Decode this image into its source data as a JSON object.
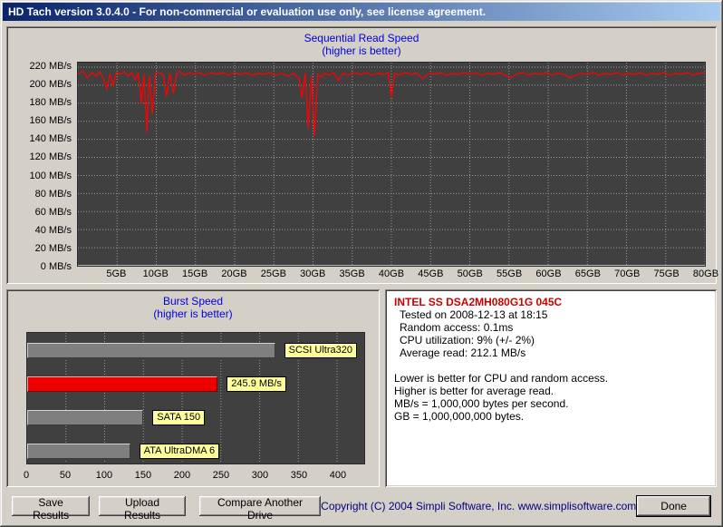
{
  "window": {
    "title": "HD Tach version 3.0.4.0  - For non-commercial or evaluation use only, see license agreement."
  },
  "chart_data": [
    {
      "type": "line",
      "title": "Sequential Read Speed",
      "subtitle": "(higher is better)",
      "series_name": "Sequential read speed",
      "x_unit": "GB",
      "y_unit": "MB/s",
      "xlim": [
        0,
        80
      ],
      "ylim": [
        0,
        225
      ],
      "grid": "dotted",
      "legend": "none",
      "line_color": "#ff0000",
      "plot_bg": "#404040",
      "y_ticks": [
        {
          "v": 220,
          "label": "220 MB/s"
        },
        {
          "v": 200,
          "label": "200 MB/s"
        },
        {
          "v": 180,
          "label": "180 MB/s"
        },
        {
          "v": 160,
          "label": "160 MB/s"
        },
        {
          "v": 140,
          "label": "140 MB/s"
        },
        {
          "v": 120,
          "label": "120 MB/s"
        },
        {
          "v": 100,
          "label": "100 MB/s"
        },
        {
          "v": 80,
          "label": "80 MB/s"
        },
        {
          "v": 60,
          "label": "60 MB/s"
        },
        {
          "v": 40,
          "label": "40 MB/s"
        },
        {
          "v": 20,
          "label": "20 MB/s"
        },
        {
          "v": 0,
          "label": "0 MB/s"
        }
      ],
      "x_ticks": [
        {
          "v": 5,
          "label": "5GB"
        },
        {
          "v": 10,
          "label": "10GB"
        },
        {
          "v": 15,
          "label": "15GB"
        },
        {
          "v": 20,
          "label": "20GB"
        },
        {
          "v": 25,
          "label": "25GB"
        },
        {
          "v": 30,
          "label": "30GB"
        },
        {
          "v": 35,
          "label": "35GB"
        },
        {
          "v": 40,
          "label": "40GB"
        },
        {
          "v": 45,
          "label": "45GB"
        },
        {
          "v": 50,
          "label": "50GB"
        },
        {
          "v": 55,
          "label": "55GB"
        },
        {
          "v": 60,
          "label": "60GB"
        },
        {
          "v": 65,
          "label": "65GB"
        },
        {
          "v": 70,
          "label": "70GB"
        },
        {
          "v": 75,
          "label": "75GB"
        },
        {
          "v": 80,
          "label": "80GB"
        }
      ],
      "points": [
        [
          0,
          213
        ],
        [
          0.7,
          215
        ],
        [
          1.2,
          208
        ],
        [
          1.8,
          214
        ],
        [
          2.3,
          210
        ],
        [
          2.8,
          215
        ],
        [
          3.3,
          206
        ],
        [
          3.7,
          196
        ],
        [
          4.1,
          213
        ],
        [
          4.5,
          199
        ],
        [
          4.9,
          214
        ],
        [
          5.4,
          212
        ],
        [
          5.9,
          215
        ],
        [
          6.4,
          210
        ],
        [
          6.9,
          214
        ],
        [
          7.3,
          206
        ],
        [
          7.7,
          213
        ],
        [
          8.1,
          179
        ],
        [
          8.4,
          212
        ],
        [
          8.8,
          148
        ],
        [
          9.1,
          211
        ],
        [
          9.5,
          168
        ],
        [
          9.9,
          213
        ],
        [
          10.4,
          214
        ],
        [
          10.9,
          211
        ],
        [
          11.3,
          187
        ],
        [
          11.7,
          213
        ],
        [
          12.2,
          191
        ],
        [
          12.6,
          213
        ],
        [
          13,
          215
        ],
        [
          13.6,
          211
        ],
        [
          14.2,
          214
        ],
        [
          14.8,
          212
        ],
        [
          15.5,
          214
        ],
        [
          16.2,
          211
        ],
        [
          17,
          214
        ],
        [
          17.8,
          212
        ],
        [
          18.5,
          214
        ],
        [
          19.2,
          211
        ],
        [
          20,
          214
        ],
        [
          20.8,
          212
        ],
        [
          21.5,
          214
        ],
        [
          22.2,
          211
        ],
        [
          23,
          213
        ],
        [
          23.8,
          212
        ],
        [
          24.5,
          214
        ],
        [
          25.2,
          211
        ],
        [
          26,
          213
        ],
        [
          26.8,
          210
        ],
        [
          27.5,
          213
        ],
        [
          28.2,
          208
        ],
        [
          28.6,
          186
        ],
        [
          29,
          213
        ],
        [
          29.4,
          152
        ],
        [
          29.8,
          211
        ],
        [
          30.2,
          144
        ],
        [
          30.6,
          212
        ],
        [
          31,
          209
        ],
        [
          31.5,
          213
        ],
        [
          32,
          211
        ],
        [
          32.6,
          214
        ],
        [
          33.2,
          205
        ],
        [
          33.8,
          213
        ],
        [
          34.5,
          211
        ],
        [
          35.2,
          214
        ],
        [
          36,
          212
        ],
        [
          36.8,
          214
        ],
        [
          37.5,
          211
        ],
        [
          38.2,
          213
        ],
        [
          39,
          212
        ],
        [
          39.6,
          214
        ],
        [
          40,
          187
        ],
        [
          40.4,
          213
        ],
        [
          41,
          211
        ],
        [
          41.8,
          214
        ],
        [
          42.5,
          212
        ],
        [
          43.2,
          214
        ],
        [
          44,
          207
        ],
        [
          44.8,
          213
        ],
        [
          45.5,
          212
        ],
        [
          46.2,
          214
        ],
        [
          47,
          211
        ],
        [
          47.8,
          213
        ],
        [
          48.5,
          212
        ],
        [
          49.2,
          214
        ],
        [
          50,
          212
        ],
        [
          50.8,
          214
        ],
        [
          51.5,
          211
        ],
        [
          52.2,
          213
        ],
        [
          53,
          212
        ],
        [
          53.8,
          214
        ],
        [
          54.5,
          211
        ],
        [
          55.2,
          208
        ],
        [
          56,
          212
        ],
        [
          56.8,
          214
        ],
        [
          57.5,
          211
        ],
        [
          58.2,
          213
        ],
        [
          59,
          212
        ],
        [
          59.8,
          214
        ],
        [
          60.5,
          211
        ],
        [
          61.2,
          213
        ],
        [
          62,
          212
        ],
        [
          62.8,
          208
        ],
        [
          63.5,
          211
        ],
        [
          64.2,
          213
        ],
        [
          65,
          212
        ],
        [
          65.8,
          214
        ],
        [
          66.5,
          211
        ],
        [
          67.2,
          213
        ],
        [
          68,
          212
        ],
        [
          68.8,
          214
        ],
        [
          69.5,
          211
        ],
        [
          70.2,
          213
        ],
        [
          71,
          212
        ],
        [
          71.8,
          214
        ],
        [
          72.5,
          211
        ],
        [
          73.2,
          213
        ],
        [
          74,
          212
        ],
        [
          74.8,
          214
        ],
        [
          75.5,
          211
        ],
        [
          76.2,
          213
        ],
        [
          77,
          212
        ],
        [
          77.8,
          214
        ],
        [
          78.5,
          211
        ],
        [
          79.2,
          213
        ],
        [
          80,
          214
        ]
      ]
    },
    {
      "type": "bar",
      "orientation": "horizontal",
      "title": "Burst Speed",
      "subtitle": "(higher is better)",
      "x_unit": "MB/s",
      "xlim": [
        0,
        435
      ],
      "grid": "dotted",
      "plot_bg": "#404040",
      "label_bg": "#ffff9c",
      "x_ticks": [
        {
          "v": 0,
          "label": "0"
        },
        {
          "v": 50,
          "label": "50"
        },
        {
          "v": 100,
          "label": "100"
        },
        {
          "v": 150,
          "label": "150"
        },
        {
          "v": 200,
          "label": "200"
        },
        {
          "v": 250,
          "label": "250"
        },
        {
          "v": 300,
          "label": "300"
        },
        {
          "v": 350,
          "label": "350"
        },
        {
          "v": 400,
          "label": "400"
        }
      ],
      "bars": [
        {
          "label": "SCSI Ultra320",
          "value": 320,
          "color": "#7f7f7f"
        },
        {
          "label": "245.9 MB/s",
          "value": 245.9,
          "color": "#ee0000"
        },
        {
          "label": "SATA 150",
          "value": 150,
          "color": "#7f7f7f"
        },
        {
          "label": "ATA UltraDMA 6",
          "value": 133,
          "color": "#7f7f7f"
        }
      ]
    }
  ],
  "info": {
    "drive_name": "INTEL SS DSA2MH080G1G 045C",
    "details": [
      "Tested on 2008-12-13 at 18:15",
      "Random access: 0.1ms",
      "CPU utilization: 9% (+/- 2%)",
      "Average read: 212.1 MB/s"
    ],
    "notes": [
      "Lower is better for CPU and random access.",
      "Higher is better for average read.",
      "MB/s = 1,000,000 bytes per second.",
      "GB = 1,000,000,000 bytes."
    ]
  },
  "buttons": {
    "save": "Save Results",
    "upload": "Upload Results",
    "compare": "Compare Another Drive",
    "done": "Done"
  },
  "footer": {
    "copyright": "Copyright (C) 2004 Simpli Software, Inc. www.simplisoftware.com"
  }
}
